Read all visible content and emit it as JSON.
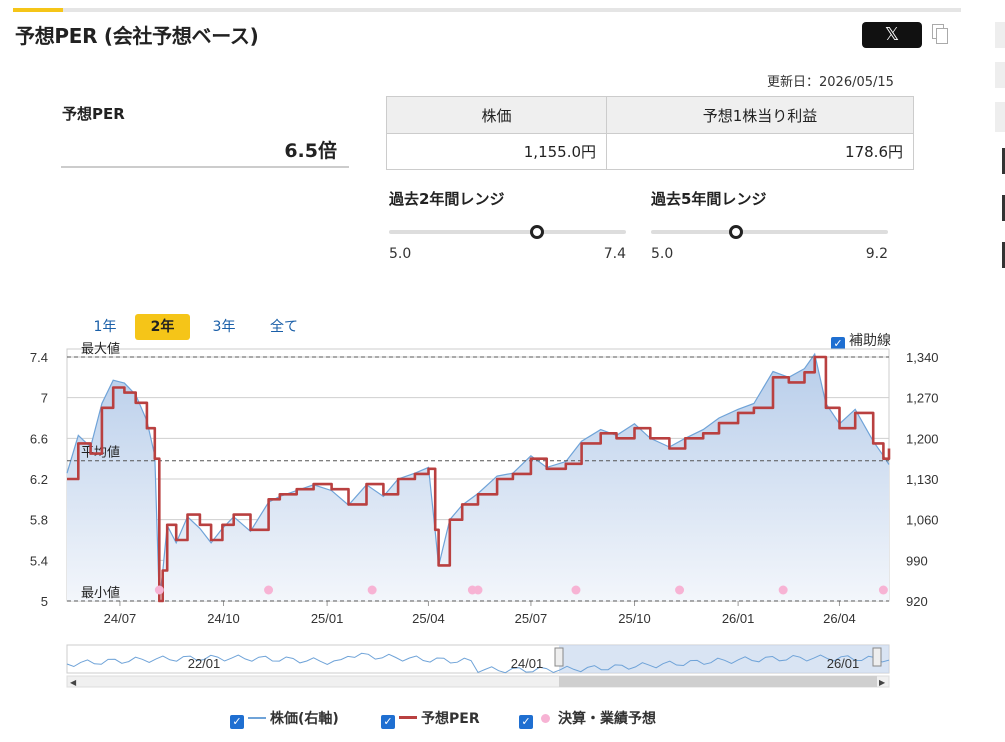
{
  "page": {
    "title": "予想PER (会社予想ベース)",
    "x_button": "𝕏",
    "updated": "更新日：2026/05/15"
  },
  "summary": {
    "per_label": "予想PER",
    "per_value": "6.5倍"
  },
  "info_table": {
    "headers": [
      "株価",
      "予想1株当り利益"
    ],
    "values": [
      "1,155.0円",
      "178.6円"
    ]
  },
  "ranges": [
    {
      "title": "過去2年間レンジ",
      "min": "5.0",
      "max": "7.4",
      "current": 6.5,
      "min_val": 5.0,
      "max_val": 7.4
    },
    {
      "title": "過去5年間レンジ",
      "min": "5.0",
      "max": "9.2",
      "current": 6.5,
      "min_val": 5.0,
      "max_val": 9.2
    }
  ],
  "period_tabs": [
    "1年",
    "2年",
    "3年",
    "全て"
  ],
  "active_tab": 1,
  "aux_label": "補助線",
  "legend": {
    "price": "株価(右軸)",
    "per": "予想PER",
    "earnings": "決算・業績予想"
  },
  "colors": {
    "per": "#b94040",
    "price": "#6fa3d8",
    "fill": "#dbe6f4",
    "earnings": "#f7b3d4",
    "accent": "#f5c518"
  },
  "chart_data": {
    "type": "line",
    "title": "",
    "ylabel_left": "",
    "ylim_left": [
      5,
      7.4
    ],
    "yticks_left": [
      "5",
      "5.4",
      "5.8",
      "6.2",
      "6.6",
      "7",
      "7.4"
    ],
    "ylim_right": [
      920,
      1340
    ],
    "yticks_right": [
      "920",
      "990",
      "1,060",
      "1,130",
      "1,200",
      "1,270",
      "1,340"
    ],
    "xticks": [
      "24/07",
      "24/10",
      "25/01",
      "25/04",
      "25/07",
      "25/10",
      "26/01",
      "26/04"
    ],
    "xtick_dates": [
      "2024-07-01",
      "2024-10-01",
      "2025-01-01",
      "2025-04-01",
      "2025-07-01",
      "2025-10-01",
      "2026-01-01",
      "2026-04-01"
    ],
    "x_range": [
      "2024-05-15",
      "2026-05-15"
    ],
    "reference_lines": [
      {
        "label": "最大値",
        "value": 7.4
      },
      {
        "label": "平均値",
        "value": 6.38
      },
      {
        "label": "最小値",
        "value": 5.0
      }
    ],
    "series": [
      {
        "name": "予想PER",
        "axis": "left",
        "x": [
          "2024-05-15",
          "2024-05-25",
          "2024-06-05",
          "2024-06-15",
          "2024-06-25",
          "2024-07-05",
          "2024-07-15",
          "2024-07-25",
          "2024-08-01",
          "2024-08-05",
          "2024-08-08",
          "2024-08-12",
          "2024-08-20",
          "2024-08-30",
          "2024-09-10",
          "2024-09-20",
          "2024-09-30",
          "2024-10-10",
          "2024-10-25",
          "2024-11-10",
          "2024-11-20",
          "2024-12-05",
          "2024-12-20",
          "2025-01-05",
          "2025-01-20",
          "2025-02-05",
          "2025-02-20",
          "2025-03-05",
          "2025-03-20",
          "2025-04-01",
          "2025-04-07",
          "2025-04-10",
          "2025-04-20",
          "2025-05-01",
          "2025-05-15",
          "2025-06-01",
          "2025-06-15",
          "2025-07-01",
          "2025-07-15",
          "2025-08-01",
          "2025-08-15",
          "2025-09-01",
          "2025-09-15",
          "2025-10-01",
          "2025-10-15",
          "2025-11-01",
          "2025-11-15",
          "2025-12-01",
          "2025-12-15",
          "2026-01-01",
          "2026-01-15",
          "2026-02-01",
          "2026-02-15",
          "2026-03-01",
          "2026-03-10",
          "2026-03-20",
          "2026-04-01",
          "2026-04-15",
          "2026-05-01",
          "2026-05-10",
          "2026-05-15"
        ],
        "values": [
          6.2,
          6.55,
          6.45,
          6.9,
          7.1,
          7.05,
          6.95,
          6.7,
          6.4,
          5.0,
          5.3,
          5.75,
          5.6,
          5.85,
          5.75,
          5.6,
          5.75,
          5.85,
          5.7,
          6.0,
          6.05,
          6.1,
          6.15,
          6.1,
          5.95,
          6.15,
          6.05,
          6.2,
          6.25,
          6.3,
          5.7,
          5.35,
          5.8,
          5.95,
          6.05,
          6.2,
          6.25,
          6.4,
          6.3,
          6.35,
          6.55,
          6.65,
          6.6,
          6.7,
          6.6,
          6.5,
          6.6,
          6.65,
          6.75,
          6.85,
          6.9,
          7.2,
          7.15,
          7.25,
          7.4,
          6.9,
          6.7,
          6.85,
          6.55,
          6.4,
          6.5
        ]
      },
      {
        "name": "株価(右軸)",
        "axis": "right",
        "x": [
          "2024-05-15",
          "2024-05-25",
          "2024-06-05",
          "2024-06-15",
          "2024-06-25",
          "2024-07-05",
          "2024-07-15",
          "2024-07-25",
          "2024-08-01",
          "2024-08-05",
          "2024-08-08",
          "2024-08-12",
          "2024-08-20",
          "2024-08-30",
          "2024-09-10",
          "2024-09-20",
          "2024-09-30",
          "2024-10-10",
          "2024-10-25",
          "2024-11-10",
          "2024-11-20",
          "2024-12-05",
          "2024-12-20",
          "2025-01-05",
          "2025-01-20",
          "2025-02-05",
          "2025-02-20",
          "2025-03-05",
          "2025-03-20",
          "2025-04-01",
          "2025-04-07",
          "2025-04-10",
          "2025-04-20",
          "2025-05-01",
          "2025-05-15",
          "2025-06-01",
          "2025-06-15",
          "2025-07-01",
          "2025-07-15",
          "2025-08-01",
          "2025-08-15",
          "2025-09-01",
          "2025-09-15",
          "2025-10-01",
          "2025-10-15",
          "2025-11-01",
          "2025-11-15",
          "2025-12-01",
          "2025-12-15",
          "2026-01-01",
          "2026-01-15",
          "2026-02-01",
          "2026-02-15",
          "2026-03-01",
          "2026-03-10",
          "2026-03-20",
          "2026-04-01",
          "2026-04-15",
          "2026-05-01",
          "2026-05-10",
          "2026-05-15"
        ],
        "values": [
          1140,
          1205,
          1185,
          1260,
          1300,
          1295,
          1275,
          1230,
          1170,
          920,
          970,
          1050,
          1020,
          1065,
          1045,
          1020,
          1045,
          1065,
          1040,
          1090,
          1100,
          1110,
          1120,
          1110,
          1085,
          1120,
          1100,
          1130,
          1140,
          1150,
          1040,
          980,
          1060,
          1085,
          1105,
          1135,
          1140,
          1170,
          1150,
          1160,
          1195,
          1215,
          1205,
          1225,
          1200,
          1185,
          1200,
          1215,
          1235,
          1250,
          1260,
          1315,
          1305,
          1320,
          1345,
          1260,
          1225,
          1250,
          1195,
          1170,
          1155
        ]
      }
    ],
    "earnings_events": [
      "2024-08-05",
      "2024-11-10",
      "2025-02-10",
      "2025-05-10",
      "2025-05-15",
      "2025-08-10",
      "2025-11-10",
      "2026-02-10",
      "2026-05-10"
    ],
    "navigator_labels": [
      "22/01",
      "24/01",
      "26/01"
    ]
  }
}
